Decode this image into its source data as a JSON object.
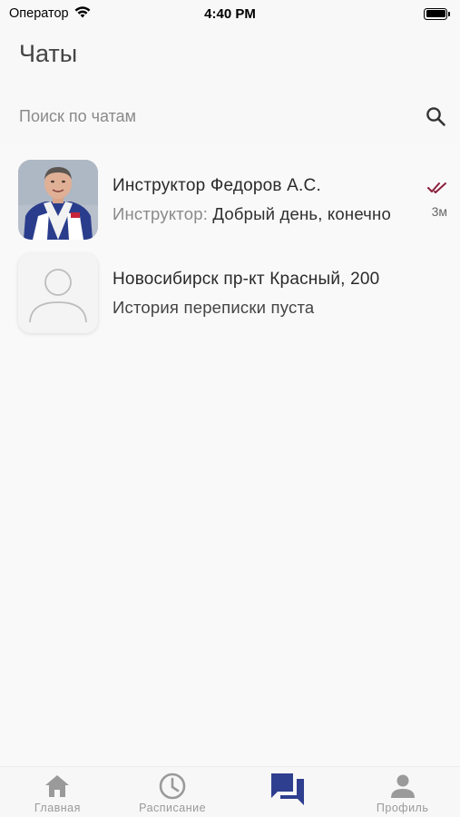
{
  "status_bar": {
    "carrier": "Оператор",
    "time": "4:40 PM"
  },
  "page": {
    "title": "Чаты"
  },
  "search": {
    "placeholder": "Поиск по чатам"
  },
  "chats": [
    {
      "name": "Инструктор Федоров А.С.",
      "preview_sender": "Инструктор:",
      "preview_text": "Добрый день, конечно",
      "time": "3м",
      "read_status": "double-check",
      "avatar": "photo"
    },
    {
      "name": "Новосибирск пр-кт Красный, 200",
      "preview_text": "История переписки пуста",
      "avatar": "placeholder-person"
    }
  ],
  "tab_bar": {
    "tabs": [
      {
        "label": "Главная",
        "icon": "home-icon",
        "active": false
      },
      {
        "label": "Расписание",
        "icon": "clock-icon",
        "active": false
      },
      {
        "label": "",
        "icon": "chats-icon",
        "active": true
      },
      {
        "label": "Профиль",
        "icon": "person-icon",
        "active": false
      }
    ]
  },
  "colors": {
    "active_tab": "#2f3f8f",
    "inactive_tab": "#9a9a9a",
    "read_check": "#8a1f3c"
  }
}
